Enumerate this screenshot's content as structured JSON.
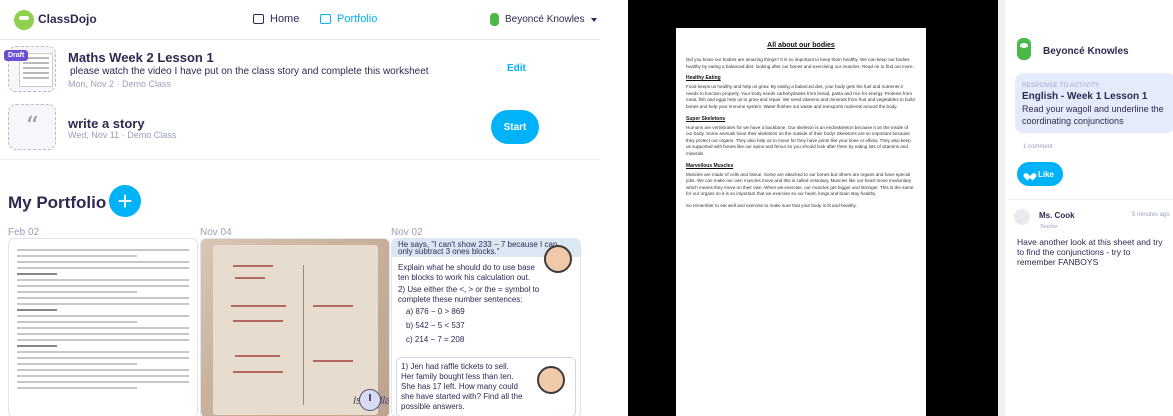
{
  "app": {
    "logo": "ClassDojo",
    "nav": {
      "home": "Home",
      "portfolio": "Portfolio"
    },
    "user": "Beyoncé Knowles"
  },
  "activities": [
    {
      "title": "Maths Week 2 Lesson 1",
      "description": "please watch the video I have put on the class story and complete this worksheet",
      "meta": "Mon, Nov 2 · Demo Class",
      "badge": "Draft",
      "action": "Edit"
    },
    {
      "title": "write a story",
      "meta": "Wed, Nov 11 · Demo Class",
      "icon": "quote-icon",
      "action": "Start"
    }
  ],
  "portfolio": {
    "title": "My Portfolio",
    "add_label": "+",
    "items": [
      {
        "date": "Feb 02"
      },
      {
        "date": "Nov 04",
        "caption": "Isabella"
      },
      {
        "date": "Nov 02",
        "banner": "He says, \"I can't show 233 − 7 because I can only subtract 3 ones blocks.\"",
        "q1": "Explain what he should do to use base ten blocks to work his calculation out.",
        "q2": "2) Use either the <, > or the = symbol to complete these number sentences:",
        "a": "a) 876 − 0 > 869",
        "b": "b) 542 − 5 < 537",
        "c": "c) 214 − 7 = 208",
        "q3": "1) Jen had raffle tickets to sell. Her family bought less than ten. She has 17 left. How many could she have started with? Find all the possible answers."
      }
    ]
  },
  "document": {
    "title": "All about our bodies",
    "intro": "Did you know our bodies are amazing things? It is so important to keep them healthy. We can keep our bodies healthy by eating a balanced diet, looking after our bones and exercising our muscles. Read on to find out more..",
    "sections": [
      {
        "heading": "Healthy Eating",
        "text": "Food keeps us healthy and help us grow. By eating a balanced diet, your body gets the fuel and nutrients it needs to function properly. Your body needs carbohydrates from bread, pasta and rice for energy. Proteins from meat, fish and eggs help us to grow and repair. We need vitamins and minerals from fruit and vegetables to build bones and help your immune system. Water flushes out waste and transports nutrients around the body."
      },
      {
        "heading": "Super Skeletons",
        "text": "Humans are vertebrates for we have a backbone. Our skeleton is an endoskeleton because it on the inside of our body. Some animals have their skeletons on the outside of their body! Skeletons are so important because they protect our organs. They also help us to move for they have joints like your knee or elbow. They also keep us supported with bones like our spine and femur so you should look after them by eating lots of vitamins and minerals."
      },
      {
        "heading": "Marvellous Muscles",
        "text": "Muscles are made of cells and tissue. Some are attached to our bones but others are organs and have special jobs. We can make our own muscles move and this is called voluntary. Muscles like our heart move involuntary which means they move on their own. When we exercise, our muscles get bigger and stronger. This is the same for our organs so it is so important that we exercise so our heart, lungs and brain stay healthy."
      }
    ],
    "outro": "So remember to eat well and exercise to make sure that your body is fit and healthy."
  },
  "sidebar": {
    "student": "Beyoncé Knowles",
    "response_label": "RESPONSE TO ACTIVITY",
    "activity_title": "English - Week 1 Lesson 1",
    "activity_desc": "Read your wagoll and underline the coordinating conjunctions",
    "comment_count": "1 comment",
    "like": "Like",
    "comment": {
      "author": "Ms. Cook",
      "role": "Teacher",
      "time": "5 minutes ago",
      "text": "Have another look at this sheet and try to find the conjunctions - try to remember FANBOYS"
    }
  },
  "colors": {
    "accent": "#00b2f7",
    "brand": "#2c2a50",
    "draft": "#6b4fd3",
    "green": "#4cb849"
  }
}
